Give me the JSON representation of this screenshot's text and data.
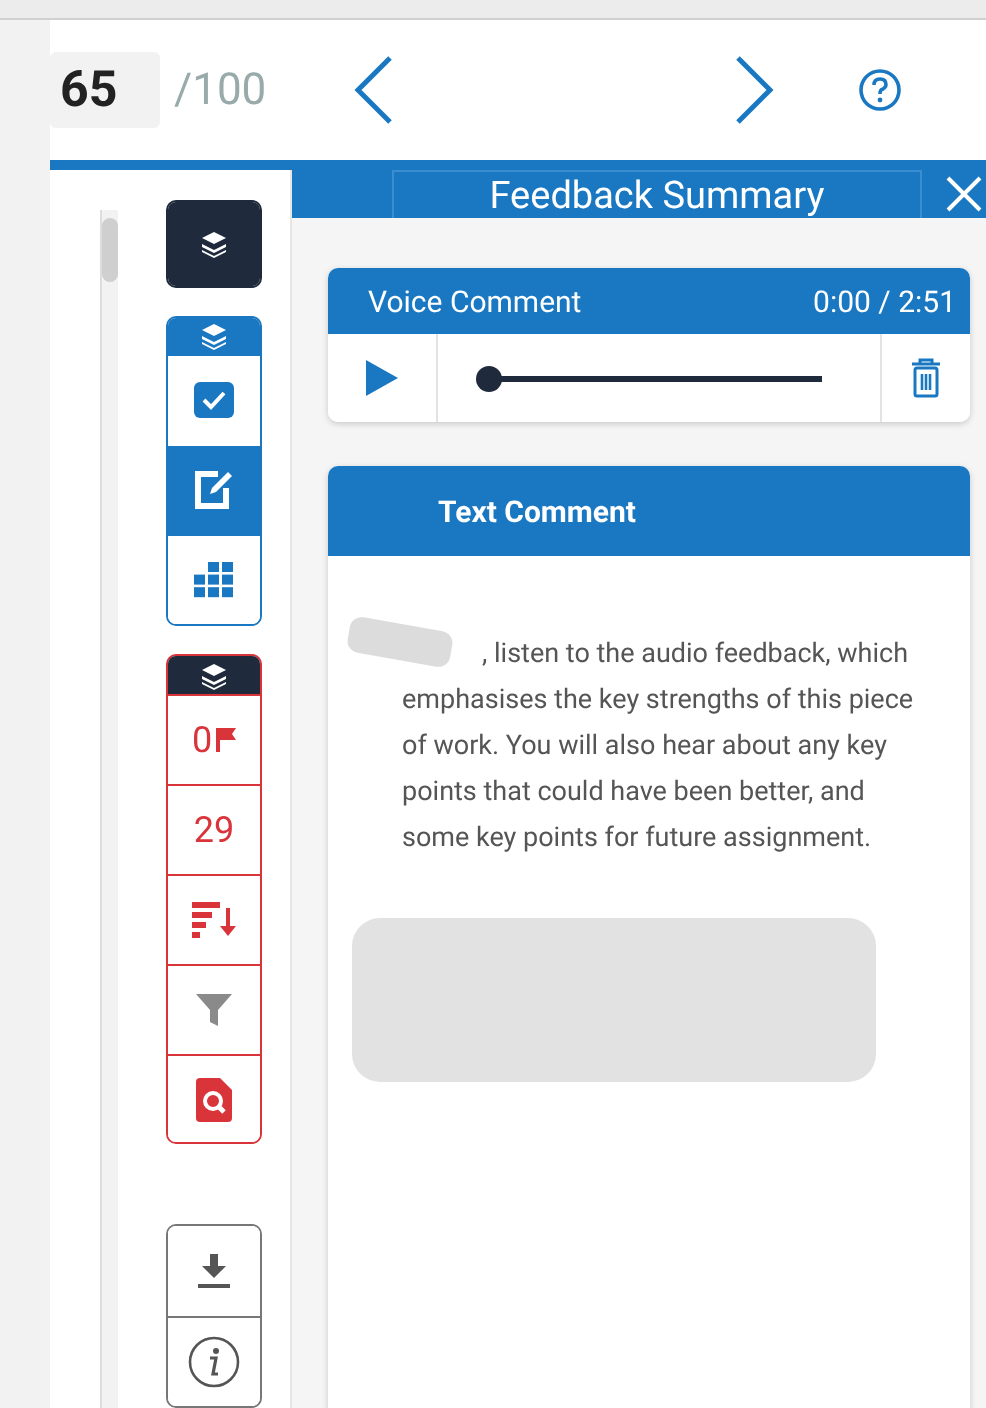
{
  "header": {
    "score": "65",
    "total": "/100"
  },
  "tool_groups": [
    {
      "kind": "single",
      "items": [
        {
          "kind": "layers"
        }
      ]
    },
    {
      "kind": "blue",
      "items": [
        {
          "kind": "layers-head"
        },
        {
          "kind": "check",
          "selected": false
        },
        {
          "kind": "edit",
          "selected": true
        },
        {
          "kind": "grid",
          "selected": false
        }
      ]
    },
    {
      "kind": "red",
      "items": [
        {
          "kind": "layers-head"
        },
        {
          "kind": "flag-count",
          "label": "0"
        },
        {
          "kind": "count",
          "label": "29"
        },
        {
          "kind": "sort"
        },
        {
          "kind": "filter"
        },
        {
          "kind": "doc-search"
        }
      ]
    },
    {
      "kind": "grey",
      "items": [
        {
          "kind": "download"
        },
        {
          "kind": "info"
        }
      ]
    }
  ],
  "panel": {
    "title": "Feedback Summary"
  },
  "voice_comment": {
    "title": "Voice Comment",
    "time": "0:00 / 2:51",
    "level": 0
  },
  "text_comment": {
    "title": "Text Comment",
    "text": ", listen to the audio feedback, which emphasises the key strengths of this piece of work. You will also hear about any  key points that could have been better, and some key points for future assignment."
  }
}
